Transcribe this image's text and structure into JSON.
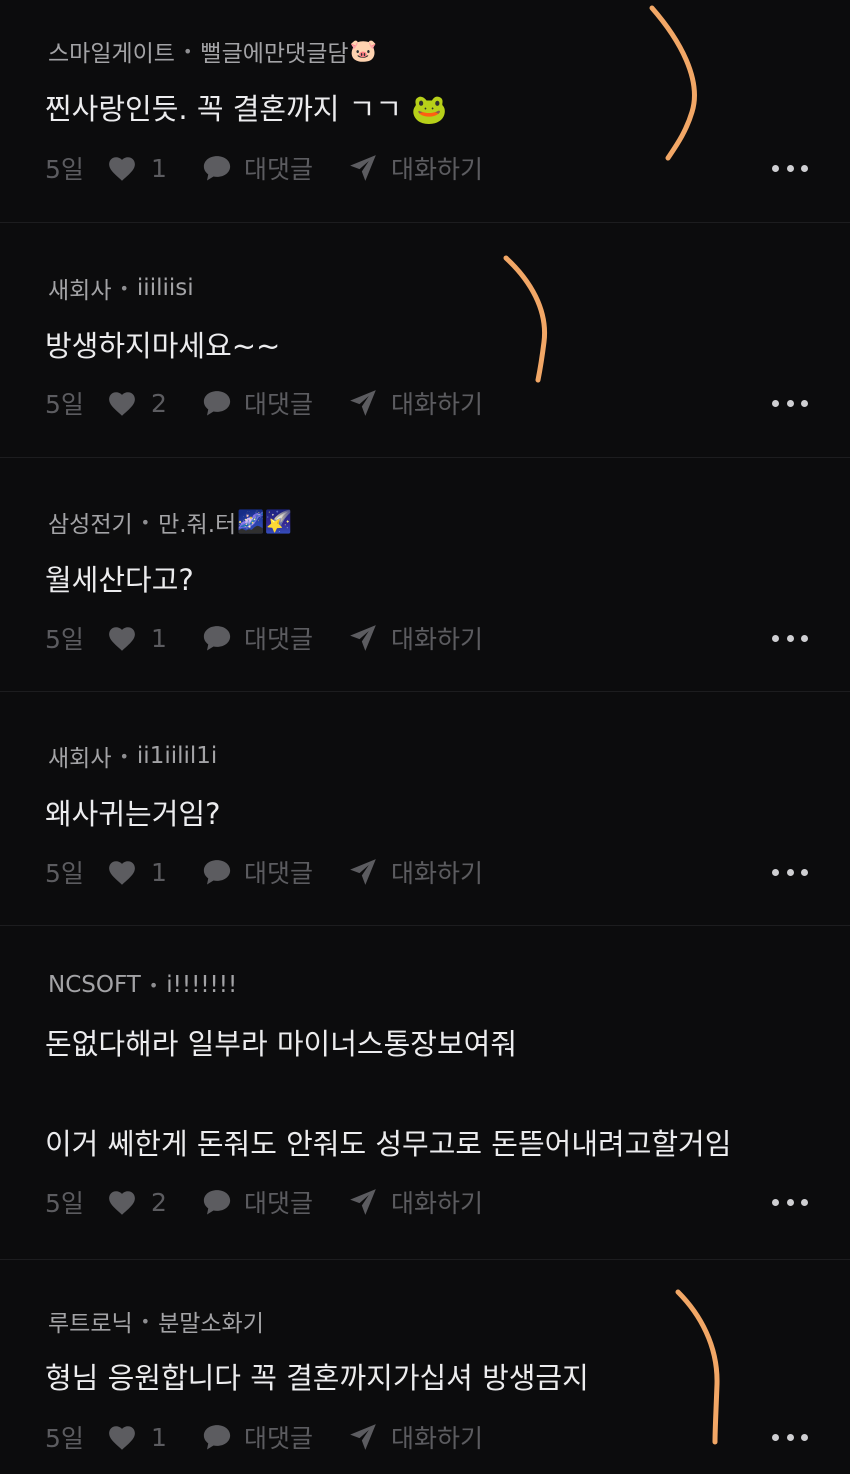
{
  "comments": [
    {
      "company": "스마일게이트",
      "nick": "뻘글에만댓글담",
      "emoji": "🐷",
      "text": "찐사랑인듯. 꼭 결혼까지 ㄱㄱ 🐸",
      "text2": "",
      "time": "5일",
      "likes": "1",
      "reply_label": "대댓글",
      "chat_label": "대화하기"
    },
    {
      "company": "새회사",
      "nick": "iiiliisi",
      "emoji": "",
      "text": "방생하지마세요~~",
      "text2": "",
      "time": "5일",
      "likes": "2",
      "reply_label": "대댓글",
      "chat_label": "대화하기"
    },
    {
      "company": "삼성전기",
      "nick": "만.줘.터",
      "emoji": "🌌🌠",
      "text": "월세산다고?",
      "text2": "",
      "time": "5일",
      "likes": "1",
      "reply_label": "대댓글",
      "chat_label": "대화하기"
    },
    {
      "company": "새회사",
      "nick": "ii1iilil1i",
      "emoji": "",
      "text": "왜사귀는거임?",
      "text2": "",
      "time": "5일",
      "likes": "1",
      "reply_label": "대댓글",
      "chat_label": "대화하기"
    },
    {
      "company": "NCSOFT",
      "nick": "i!!!!!!!",
      "emoji": "",
      "text": "돈없다해라 일부라 마이너스통장보여줘",
      "text2": "이거 쎄한게 돈줘도 안줘도 성무고로 돈뜯어내려고할거임",
      "time": "5일",
      "likes": "2",
      "reply_label": "대댓글",
      "chat_label": "대화하기"
    },
    {
      "company": "루트로닉",
      "nick": "분말소화기",
      "emoji": "",
      "text": "형님 응원합니다 꼭 결혼까지가십셔 방생금지",
      "text2": "",
      "time": "5일",
      "likes": "1",
      "reply_label": "대댓글",
      "chat_label": "대화하기"
    }
  ],
  "colors": {
    "background": "#0c0c0d",
    "text": "#ececee",
    "meta": "#a3a3a6",
    "action": "#5c5c60",
    "annotation_stroke": "#f2a766"
  },
  "icons": [
    "heart-icon",
    "speech-bubble-icon",
    "paper-plane-icon",
    "more-dots-icon"
  ]
}
